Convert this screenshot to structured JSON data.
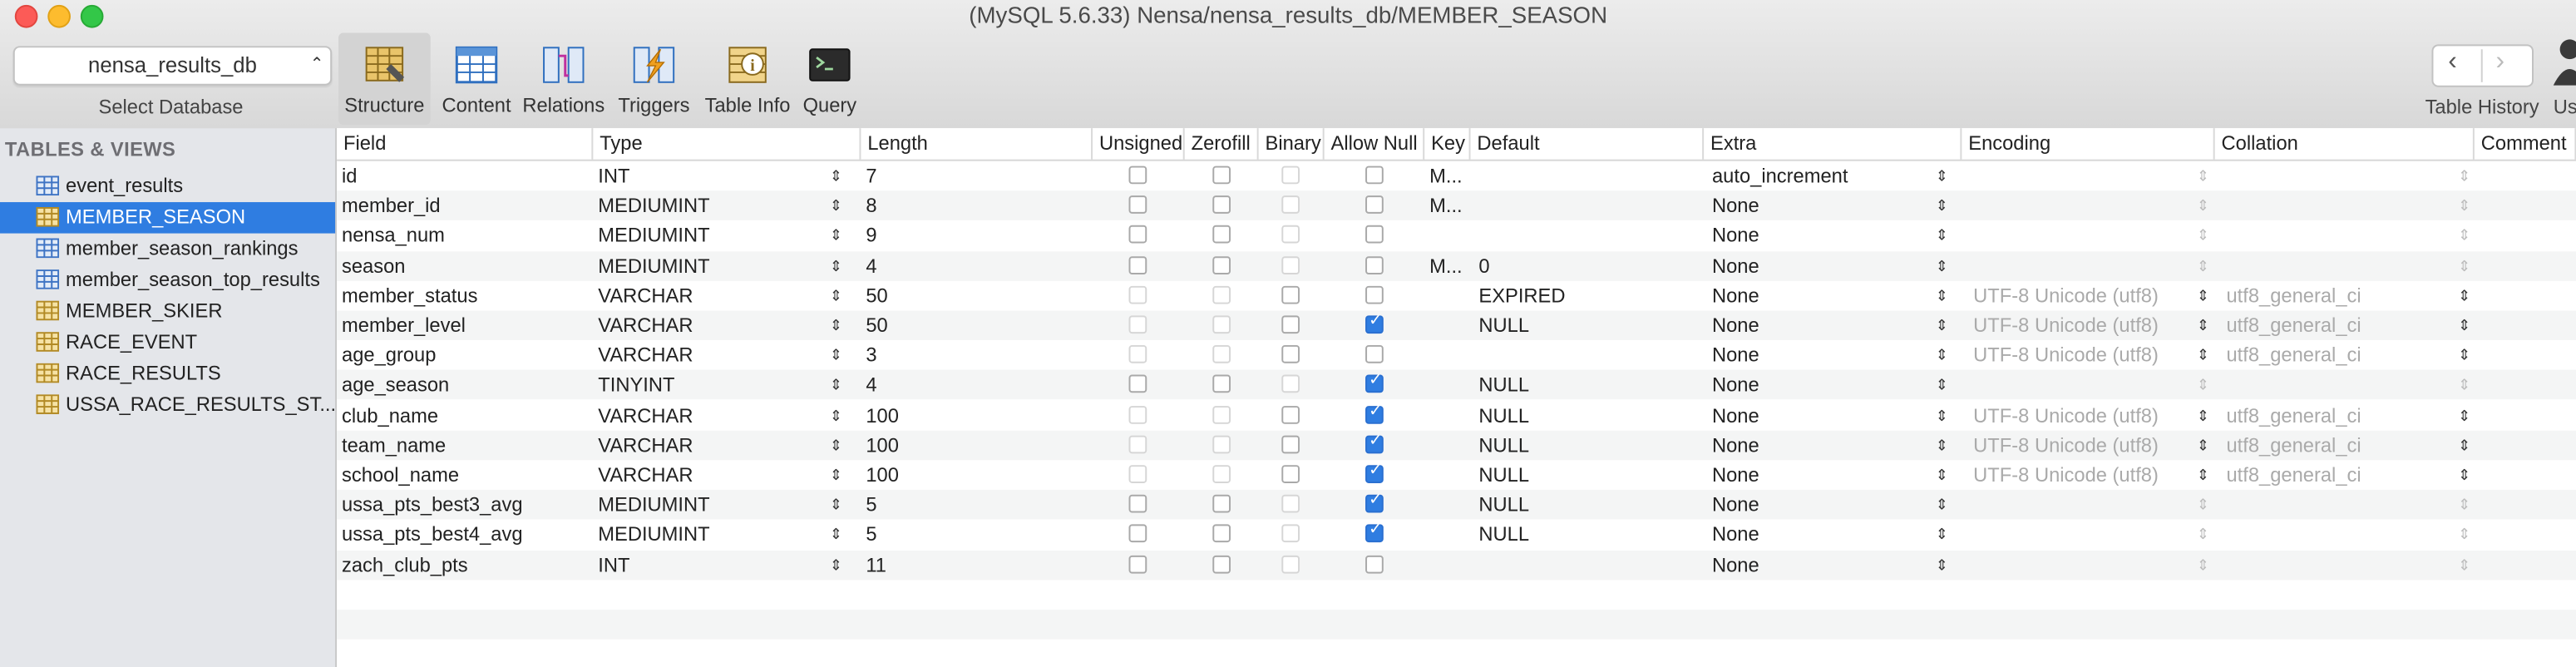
{
  "window": {
    "title": "(MySQL 5.6.33) Nensa/nensa_results_db/MEMBER_SEASON"
  },
  "db_selector": {
    "value": "nensa_results_db",
    "caption": "Select Database"
  },
  "toolbar": [
    {
      "label": "Structure",
      "icon": "structure-icon"
    },
    {
      "label": "Content",
      "icon": "content-icon"
    },
    {
      "label": "Relations",
      "icon": "relations-icon"
    },
    {
      "label": "Triggers",
      "icon": "triggers-icon"
    },
    {
      "label": "Table Info",
      "icon": "table-info-icon"
    },
    {
      "label": "Query",
      "icon": "query-icon"
    }
  ],
  "right_toolbar": {
    "history_label": "Table History",
    "user_label": "Us"
  },
  "sidebar": {
    "header": "TABLES & VIEWS",
    "items": [
      {
        "name": "event_results",
        "kind": "view"
      },
      {
        "name": "MEMBER_SEASON",
        "kind": "table"
      },
      {
        "name": "member_season_rankings",
        "kind": "view"
      },
      {
        "name": "member_season_top_results",
        "kind": "view"
      },
      {
        "name": "MEMBER_SKIER",
        "kind": "table"
      },
      {
        "name": "RACE_EVENT",
        "kind": "table"
      },
      {
        "name": "RACE_RESULTS",
        "kind": "table"
      },
      {
        "name": "USSA_RACE_RESULTS_ST...",
        "kind": "table"
      }
    ]
  },
  "columns": [
    "Field",
    "Type",
    "Length",
    "Unsigned",
    "Zerofill",
    "Binary",
    "Allow Null",
    "Key",
    "Default",
    "Extra",
    "Encoding",
    "Collation",
    "Comment"
  ],
  "rows": [
    {
      "field": "id",
      "type": "INT",
      "length": "7",
      "unsigned": false,
      "zerofill": false,
      "binary": false,
      "allow_null": false,
      "key": "M...",
      "default": "",
      "extra": "auto_increment",
      "encoding": "",
      "collation": "",
      "enabled_unsigned": true,
      "enabled_binary": false
    },
    {
      "field": "member_id",
      "type": "MEDIUMINT",
      "length": "8",
      "unsigned": false,
      "zerofill": false,
      "binary": false,
      "allow_null": false,
      "key": "M...",
      "default": "",
      "extra": "None",
      "encoding": "",
      "collation": "",
      "enabled_unsigned": true,
      "enabled_binary": false
    },
    {
      "field": "nensa_num",
      "type": "MEDIUMINT",
      "length": "9",
      "unsigned": false,
      "zerofill": false,
      "binary": false,
      "allow_null": false,
      "key": "",
      "default": "",
      "extra": "None",
      "encoding": "",
      "collation": "",
      "enabled_unsigned": true,
      "enabled_binary": false
    },
    {
      "field": "season",
      "type": "MEDIUMINT",
      "length": "4",
      "unsigned": false,
      "zerofill": false,
      "binary": false,
      "allow_null": false,
      "key": "M...",
      "default": "0",
      "extra": "None",
      "encoding": "",
      "collation": "",
      "enabled_unsigned": true,
      "enabled_binary": false
    },
    {
      "field": "member_status",
      "type": "VARCHAR",
      "length": "50",
      "unsigned": false,
      "zerofill": false,
      "binary": false,
      "allow_null": false,
      "key": "",
      "default": "EXPIRED",
      "extra": "None",
      "encoding": "UTF-8 Unicode (utf8)",
      "collation": "utf8_general_ci",
      "enabled_unsigned": false,
      "enabled_binary": true
    },
    {
      "field": "member_level",
      "type": "VARCHAR",
      "length": "50",
      "unsigned": false,
      "zerofill": false,
      "binary": false,
      "allow_null": true,
      "key": "",
      "default": "NULL",
      "extra": "None",
      "encoding": "UTF-8 Unicode (utf8)",
      "collation": "utf8_general_ci",
      "enabled_unsigned": false,
      "enabled_binary": true
    },
    {
      "field": "age_group",
      "type": "VARCHAR",
      "length": "3",
      "unsigned": false,
      "zerofill": false,
      "binary": false,
      "allow_null": false,
      "key": "",
      "default": "",
      "extra": "None",
      "encoding": "UTF-8 Unicode (utf8)",
      "collation": "utf8_general_ci",
      "enabled_unsigned": false,
      "enabled_binary": true
    },
    {
      "field": "age_season",
      "type": "TINYINT",
      "length": "4",
      "unsigned": false,
      "zerofill": false,
      "binary": false,
      "allow_null": true,
      "key": "",
      "default": "NULL",
      "extra": "None",
      "encoding": "",
      "collation": "",
      "enabled_unsigned": true,
      "enabled_binary": false
    },
    {
      "field": "club_name",
      "type": "VARCHAR",
      "length": "100",
      "unsigned": false,
      "zerofill": false,
      "binary": false,
      "allow_null": true,
      "key": "",
      "default": "NULL",
      "extra": "None",
      "encoding": "UTF-8 Unicode (utf8)",
      "collation": "utf8_general_ci",
      "enabled_unsigned": false,
      "enabled_binary": true
    },
    {
      "field": "team_name",
      "type": "VARCHAR",
      "length": "100",
      "unsigned": false,
      "zerofill": false,
      "binary": false,
      "allow_null": true,
      "key": "",
      "default": "NULL",
      "extra": "None",
      "encoding": "UTF-8 Unicode (utf8)",
      "collation": "utf8_general_ci",
      "enabled_unsigned": false,
      "enabled_binary": true
    },
    {
      "field": "school_name",
      "type": "VARCHAR",
      "length": "100",
      "unsigned": false,
      "zerofill": false,
      "binary": false,
      "allow_null": true,
      "key": "",
      "default": "NULL",
      "extra": "None",
      "encoding": "UTF-8 Unicode (utf8)",
      "collation": "utf8_general_ci",
      "enabled_unsigned": false,
      "enabled_binary": true
    },
    {
      "field": "ussa_pts_best3_avg",
      "type": "MEDIUMINT",
      "length": "5",
      "unsigned": false,
      "zerofill": false,
      "binary": false,
      "allow_null": true,
      "key": "",
      "default": "NULL",
      "extra": "None",
      "encoding": "",
      "collation": "",
      "enabled_unsigned": true,
      "enabled_binary": false
    },
    {
      "field": "ussa_pts_best4_avg",
      "type": "MEDIUMINT",
      "length": "5",
      "unsigned": false,
      "zerofill": false,
      "binary": false,
      "allow_null": true,
      "key": "",
      "default": "NULL",
      "extra": "None",
      "encoding": "",
      "collation": "",
      "enabled_unsigned": true,
      "enabled_binary": false
    },
    {
      "field": "zach_club_pts",
      "type": "INT",
      "length": "11",
      "unsigned": false,
      "zerofill": false,
      "binary": false,
      "allow_null": false,
      "key": "",
      "default": "",
      "extra": "None",
      "encoding": "",
      "collation": "",
      "enabled_unsigned": true,
      "enabled_binary": false
    }
  ]
}
